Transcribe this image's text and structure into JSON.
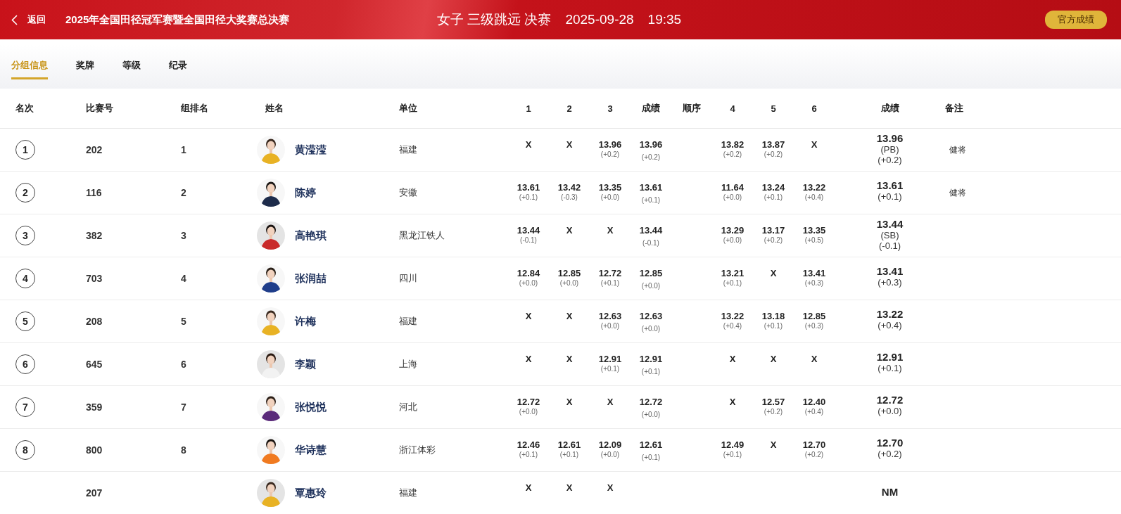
{
  "header": {
    "back": "返回",
    "competition": "2025年全国田径冠军赛暨全国田径大奖赛总决赛",
    "event": "女子 三级跳远 决赛",
    "date": "2025-09-28",
    "time": "19:35",
    "official_button": "官方成绩"
  },
  "tabs": [
    {
      "label": "分组信息",
      "selected": true
    },
    {
      "label": "奖牌",
      "selected": false
    },
    {
      "label": "等级",
      "selected": false
    },
    {
      "label": "纪录",
      "selected": false
    }
  ],
  "table": {
    "columns": [
      "名次",
      "比赛号",
      "组排名",
      "姓名",
      "单位",
      "1",
      "2",
      "3",
      "成绩",
      "顺序",
      "4",
      "5",
      "6",
      "成绩",
      "备注"
    ],
    "rows": [
      {
        "rank": "1",
        "bib": "202",
        "group_rank": "1",
        "name": "黄滢滢",
        "unit": "福建",
        "attempts_1_3": [
          {
            "mark": "X"
          },
          {
            "mark": "X"
          },
          {
            "mark": "13.96",
            "wind": "(+0.2)"
          }
        ],
        "best": {
          "mark": "13.96",
          "wind": "(+0.2)"
        },
        "attempts_4_6": [
          {
            "mark": "13.82",
            "wind": "(+0.2)"
          },
          {
            "mark": "13.87",
            "wind": "(+0.2)"
          },
          {
            "mark": "X"
          }
        ],
        "result": {
          "mark": "13.96",
          "note": "(PB)",
          "wind": "(+0.2)"
        },
        "remark": "健将"
      },
      {
        "rank": "2",
        "bib": "116",
        "group_rank": "2",
        "name": "陈婷",
        "unit": "安徽",
        "attempts_1_3": [
          {
            "mark": "13.61",
            "wind": "(+0.1)"
          },
          {
            "mark": "13.42",
            "wind": "(-0.3)"
          },
          {
            "mark": "13.35",
            "wind": "(+0.0)"
          }
        ],
        "best": {
          "mark": "13.61",
          "wind": "(+0.1)"
        },
        "attempts_4_6": [
          {
            "mark": "11.64",
            "wind": "(+0.0)"
          },
          {
            "mark": "13.24",
            "wind": "(+0.1)"
          },
          {
            "mark": "13.22",
            "wind": "(+0.4)"
          }
        ],
        "result": {
          "mark": "13.61",
          "wind": "(+0.1)"
        },
        "remark": "健将"
      },
      {
        "rank": "3",
        "bib": "382",
        "group_rank": "3",
        "name": "高艳琪",
        "unit": "黑龙江铁人",
        "attempts_1_3": [
          {
            "mark": "13.44",
            "wind": "(-0.1)"
          },
          {
            "mark": "X"
          },
          {
            "mark": "X"
          }
        ],
        "best": {
          "mark": "13.44",
          "wind": "(-0.1)"
        },
        "attempts_4_6": [
          {
            "mark": "13.29",
            "wind": "(+0.0)"
          },
          {
            "mark": "13.17",
            "wind": "(+0.2)"
          },
          {
            "mark": "13.35",
            "wind": "(+0.5)"
          }
        ],
        "result": {
          "mark": "13.44",
          "note": "(SB)",
          "wind": "(-0.1)"
        }
      },
      {
        "rank": "4",
        "bib": "703",
        "group_rank": "4",
        "name": "张润喆",
        "unit": "四川",
        "attempts_1_3": [
          {
            "mark": "12.84",
            "wind": "(+0.0)"
          },
          {
            "mark": "12.85",
            "wind": "(+0.0)"
          },
          {
            "mark": "12.72",
            "wind": "(+0.1)"
          }
        ],
        "best": {
          "mark": "12.85",
          "wind": "(+0.0)"
        },
        "attempts_4_6": [
          {
            "mark": "13.21",
            "wind": "(+0.1)"
          },
          {
            "mark": "X"
          },
          {
            "mark": "13.41",
            "wind": "(+0.3)"
          }
        ],
        "result": {
          "mark": "13.41",
          "wind": "(+0.3)"
        }
      },
      {
        "rank": "5",
        "bib": "208",
        "group_rank": "5",
        "name": "许梅",
        "unit": "福建",
        "attempts_1_3": [
          {
            "mark": "X"
          },
          {
            "mark": "X"
          },
          {
            "mark": "12.63",
            "wind": "(+0.0)"
          }
        ],
        "best": {
          "mark": "12.63",
          "wind": "(+0.0)"
        },
        "attempts_4_6": [
          {
            "mark": "13.22",
            "wind": "(+0.4)"
          },
          {
            "mark": "13.18",
            "wind": "(+0.1)"
          },
          {
            "mark": "12.85",
            "wind": "(+0.3)"
          }
        ],
        "result": {
          "mark": "13.22",
          "wind": "(+0.4)"
        }
      },
      {
        "rank": "6",
        "bib": "645",
        "group_rank": "6",
        "name": "李颖",
        "unit": "上海",
        "attempts_1_3": [
          {
            "mark": "X"
          },
          {
            "mark": "X"
          },
          {
            "mark": "12.91",
            "wind": "(+0.1)"
          }
        ],
        "best": {
          "mark": "12.91",
          "wind": "(+0.1)"
        },
        "attempts_4_6": [
          {
            "mark": "X"
          },
          {
            "mark": "X"
          },
          {
            "mark": "X"
          }
        ],
        "result": {
          "mark": "12.91",
          "wind": "(+0.1)"
        }
      },
      {
        "rank": "7",
        "bib": "359",
        "group_rank": "7",
        "name": "张悦悦",
        "unit": "河北",
        "attempts_1_3": [
          {
            "mark": "12.72",
            "wind": "(+0.0)"
          },
          {
            "mark": "X"
          },
          {
            "mark": "X"
          }
        ],
        "best": {
          "mark": "12.72",
          "wind": "(+0.0)"
        },
        "attempts_4_6": [
          {
            "mark": "X"
          },
          {
            "mark": "12.57",
            "wind": "(+0.2)"
          },
          {
            "mark": "12.40",
            "wind": "(+0.4)"
          }
        ],
        "result": {
          "mark": "12.72",
          "wind": "(+0.0)"
        }
      },
      {
        "rank": "8",
        "bib": "800",
        "group_rank": "8",
        "name": "华诗慧",
        "unit": "浙江体彩",
        "attempts_1_3": [
          {
            "mark": "12.46",
            "wind": "(+0.1)"
          },
          {
            "mark": "12.61",
            "wind": "(+0.1)"
          },
          {
            "mark": "12.09",
            "wind": "(+0.0)"
          }
        ],
        "best": {
          "mark": "12.61",
          "wind": "(+0.1)"
        },
        "attempts_4_6": [
          {
            "mark": "12.49",
            "wind": "(+0.1)"
          },
          {
            "mark": "X"
          },
          {
            "mark": "12.70",
            "wind": "(+0.2)"
          }
        ],
        "result": {
          "mark": "12.70",
          "wind": "(+0.2)"
        }
      },
      {
        "bib": "207",
        "name": "覃惠玲",
        "unit": "福建",
        "attempts_1_3": [
          {
            "mark": "X"
          },
          {
            "mark": "X"
          },
          {
            "mark": "X"
          }
        ],
        "attempts_4_6": [],
        "result": {
          "mark": "NM"
        }
      }
    ]
  }
}
